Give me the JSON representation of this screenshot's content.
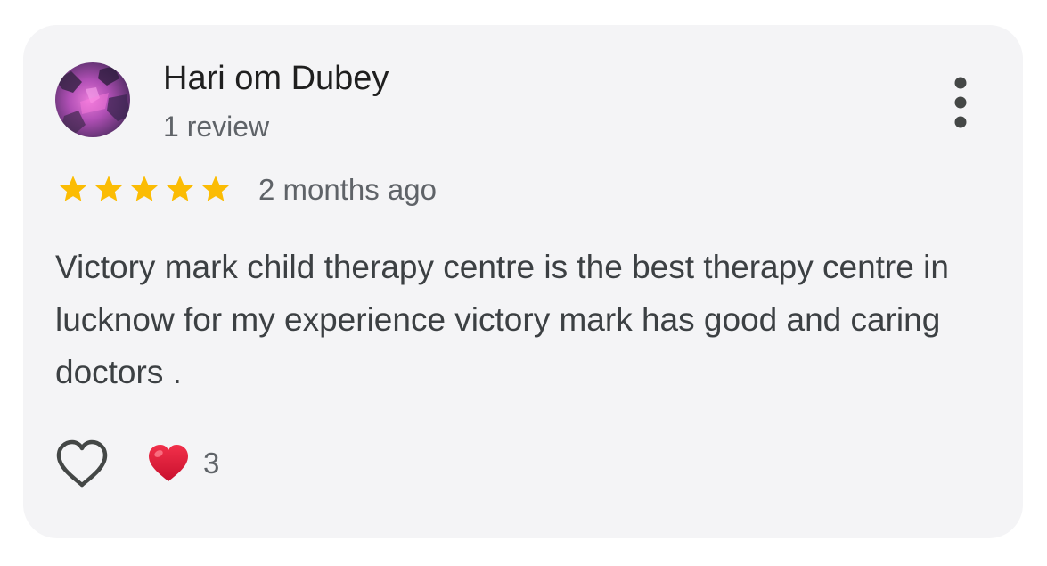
{
  "review": {
    "author_name": "Hari om Dubey",
    "review_count": "1 review",
    "rating": 5,
    "rating_max": 5,
    "date": "2 months ago",
    "text": "Victory mark child therapy centre is the best therapy centre in lucknow for my experience victory mark has good and caring doctors .",
    "reaction_count": "3"
  },
  "icons": {
    "avatar": "avatar-image",
    "more": "more-vert-icon",
    "star": "star-icon",
    "like": "heart-outline-icon",
    "reaction": "red-heart-icon"
  },
  "colors": {
    "card_background": "#f4f4f6",
    "star": "#fbbc04",
    "heart_reaction": "#e3223a",
    "primary_text": "#1f1f1f",
    "secondary_text": "#5f6368"
  }
}
